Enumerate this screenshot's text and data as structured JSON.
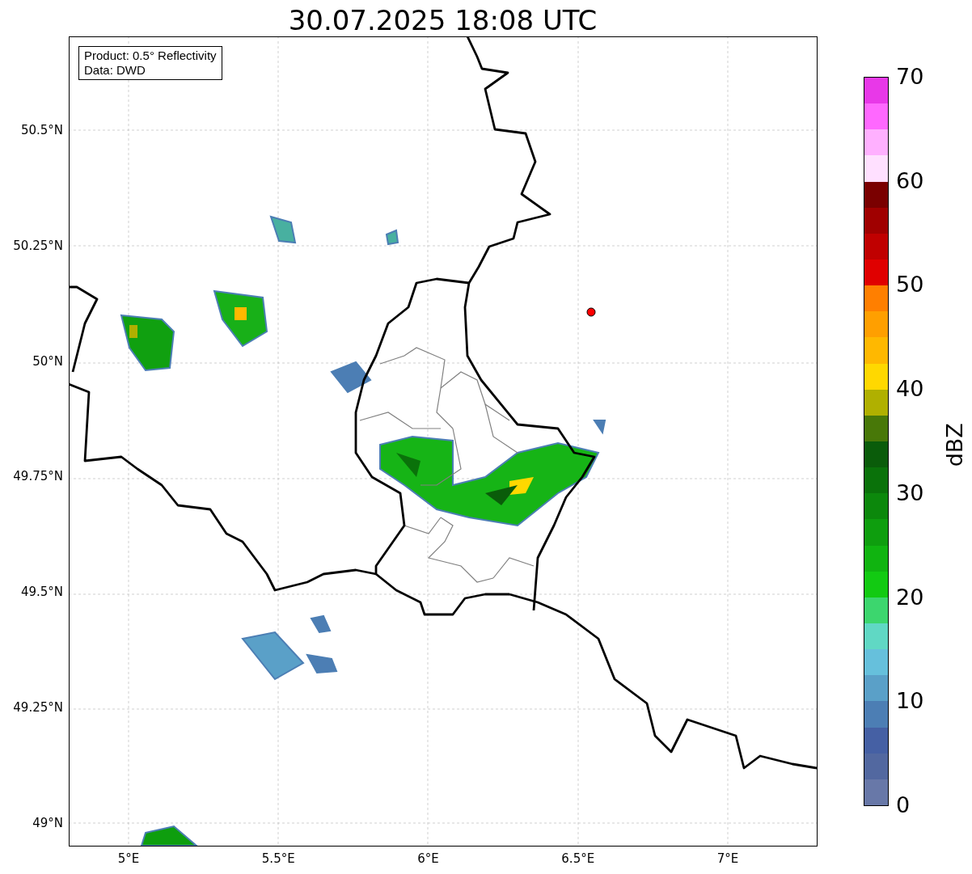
{
  "title": "30.07.2025 18:08 UTC",
  "info_box": [
    "Product: 0.5° Reflectivity",
    "Data: DWD"
  ],
  "map": {
    "x_ticks": [
      "5°E",
      "5.5°E",
      "6°E",
      "6.5°E",
      "7°E"
    ],
    "y_ticks": [
      "50.5°N",
      "50.25°N",
      "50°N",
      "49.75°N",
      "49.5°N",
      "49.25°N",
      "49°N"
    ]
  },
  "colorbar": {
    "label": "dBZ",
    "ticks": [
      "70",
      "60",
      "50",
      "40",
      "30",
      "20",
      "10",
      "0"
    ],
    "segments": [
      {
        "color": "#e838e8"
      },
      {
        "color": "#ff68ff"
      },
      {
        "color": "#ffb0ff"
      },
      {
        "color": "#ffe0ff"
      },
      {
        "color": "#7a0000"
      },
      {
        "color": "#a00000"
      },
      {
        "color": "#c00000"
      },
      {
        "color": "#e00000"
      },
      {
        "color": "#ff7f00"
      },
      {
        "color": "#ff9f00"
      },
      {
        "color": "#ffb800"
      },
      {
        "color": "#ffd800"
      },
      {
        "color": "#b0b000"
      },
      {
        "color": "#487808"
      },
      {
        "color": "#0a5c0a"
      },
      {
        "color": "#0a720a"
      },
      {
        "color": "#0c880c"
      },
      {
        "color": "#0e9e0e"
      },
      {
        "color": "#10b410"
      },
      {
        "color": "#12ca12"
      },
      {
        "color": "#3cd66e"
      },
      {
        "color": "#60d8c4"
      },
      {
        "color": "#66c0dc"
      },
      {
        "color": "#5aa0c8"
      },
      {
        "color": "#4c7eb4"
      },
      {
        "color": "#4560a4"
      },
      {
        "color": "#5268a0"
      },
      {
        "color": "#6878a8"
      }
    ]
  }
}
